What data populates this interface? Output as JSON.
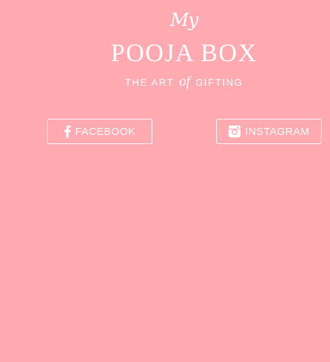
{
  "logo": {
    "my": "My",
    "name": "POOJA BOX",
    "tagline_before": "THE ART",
    "tagline_of": "of",
    "tagline_after": "GIFTING"
  },
  "social": {
    "facebook": {
      "label": "FACEBOOK",
      "icon": "facebook-icon"
    },
    "instagram": {
      "label": "INSTAGRAM",
      "icon": "instagram-icon"
    }
  },
  "colors": {
    "background": "#ffaab1",
    "foreground": "#ffffff"
  }
}
